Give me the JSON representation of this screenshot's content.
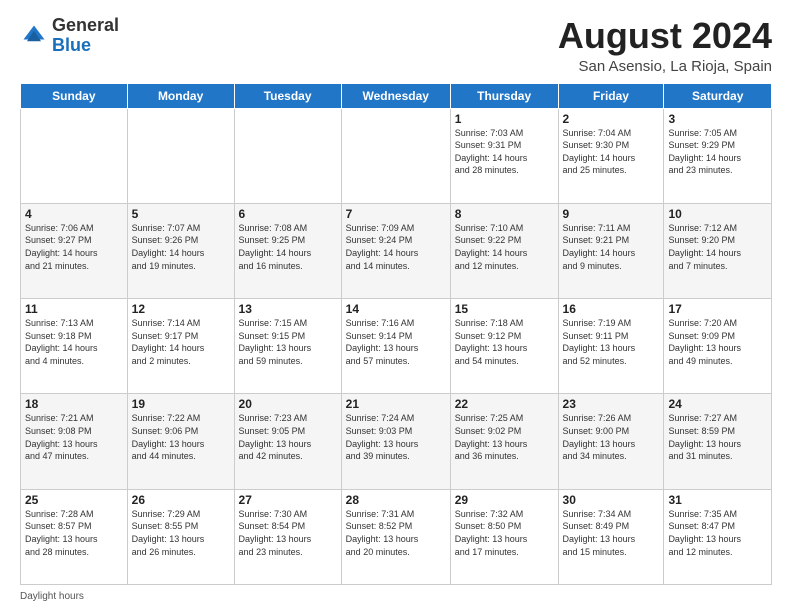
{
  "header": {
    "logo_general": "General",
    "logo_blue": "Blue",
    "month_year": "August 2024",
    "location": "San Asensio, La Rioja, Spain"
  },
  "days_of_week": [
    "Sunday",
    "Monday",
    "Tuesday",
    "Wednesday",
    "Thursday",
    "Friday",
    "Saturday"
  ],
  "weeks": [
    [
      {
        "day": "",
        "info": ""
      },
      {
        "day": "",
        "info": ""
      },
      {
        "day": "",
        "info": ""
      },
      {
        "day": "",
        "info": ""
      },
      {
        "day": "1",
        "info": "Sunrise: 7:03 AM\nSunset: 9:31 PM\nDaylight: 14 hours\nand 28 minutes."
      },
      {
        "day": "2",
        "info": "Sunrise: 7:04 AM\nSunset: 9:30 PM\nDaylight: 14 hours\nand 25 minutes."
      },
      {
        "day": "3",
        "info": "Sunrise: 7:05 AM\nSunset: 9:29 PM\nDaylight: 14 hours\nand 23 minutes."
      }
    ],
    [
      {
        "day": "4",
        "info": "Sunrise: 7:06 AM\nSunset: 9:27 PM\nDaylight: 14 hours\nand 21 minutes."
      },
      {
        "day": "5",
        "info": "Sunrise: 7:07 AM\nSunset: 9:26 PM\nDaylight: 14 hours\nand 19 minutes."
      },
      {
        "day": "6",
        "info": "Sunrise: 7:08 AM\nSunset: 9:25 PM\nDaylight: 14 hours\nand 16 minutes."
      },
      {
        "day": "7",
        "info": "Sunrise: 7:09 AM\nSunset: 9:24 PM\nDaylight: 14 hours\nand 14 minutes."
      },
      {
        "day": "8",
        "info": "Sunrise: 7:10 AM\nSunset: 9:22 PM\nDaylight: 14 hours\nand 12 minutes."
      },
      {
        "day": "9",
        "info": "Sunrise: 7:11 AM\nSunset: 9:21 PM\nDaylight: 14 hours\nand 9 minutes."
      },
      {
        "day": "10",
        "info": "Sunrise: 7:12 AM\nSunset: 9:20 PM\nDaylight: 14 hours\nand 7 minutes."
      }
    ],
    [
      {
        "day": "11",
        "info": "Sunrise: 7:13 AM\nSunset: 9:18 PM\nDaylight: 14 hours\nand 4 minutes."
      },
      {
        "day": "12",
        "info": "Sunrise: 7:14 AM\nSunset: 9:17 PM\nDaylight: 14 hours\nand 2 minutes."
      },
      {
        "day": "13",
        "info": "Sunrise: 7:15 AM\nSunset: 9:15 PM\nDaylight: 13 hours\nand 59 minutes."
      },
      {
        "day": "14",
        "info": "Sunrise: 7:16 AM\nSunset: 9:14 PM\nDaylight: 13 hours\nand 57 minutes."
      },
      {
        "day": "15",
        "info": "Sunrise: 7:18 AM\nSunset: 9:12 PM\nDaylight: 13 hours\nand 54 minutes."
      },
      {
        "day": "16",
        "info": "Sunrise: 7:19 AM\nSunset: 9:11 PM\nDaylight: 13 hours\nand 52 minutes."
      },
      {
        "day": "17",
        "info": "Sunrise: 7:20 AM\nSunset: 9:09 PM\nDaylight: 13 hours\nand 49 minutes."
      }
    ],
    [
      {
        "day": "18",
        "info": "Sunrise: 7:21 AM\nSunset: 9:08 PM\nDaylight: 13 hours\nand 47 minutes."
      },
      {
        "day": "19",
        "info": "Sunrise: 7:22 AM\nSunset: 9:06 PM\nDaylight: 13 hours\nand 44 minutes."
      },
      {
        "day": "20",
        "info": "Sunrise: 7:23 AM\nSunset: 9:05 PM\nDaylight: 13 hours\nand 42 minutes."
      },
      {
        "day": "21",
        "info": "Sunrise: 7:24 AM\nSunset: 9:03 PM\nDaylight: 13 hours\nand 39 minutes."
      },
      {
        "day": "22",
        "info": "Sunrise: 7:25 AM\nSunset: 9:02 PM\nDaylight: 13 hours\nand 36 minutes."
      },
      {
        "day": "23",
        "info": "Sunrise: 7:26 AM\nSunset: 9:00 PM\nDaylight: 13 hours\nand 34 minutes."
      },
      {
        "day": "24",
        "info": "Sunrise: 7:27 AM\nSunset: 8:59 PM\nDaylight: 13 hours\nand 31 minutes."
      }
    ],
    [
      {
        "day": "25",
        "info": "Sunrise: 7:28 AM\nSunset: 8:57 PM\nDaylight: 13 hours\nand 28 minutes."
      },
      {
        "day": "26",
        "info": "Sunrise: 7:29 AM\nSunset: 8:55 PM\nDaylight: 13 hours\nand 26 minutes."
      },
      {
        "day": "27",
        "info": "Sunrise: 7:30 AM\nSunset: 8:54 PM\nDaylight: 13 hours\nand 23 minutes."
      },
      {
        "day": "28",
        "info": "Sunrise: 7:31 AM\nSunset: 8:52 PM\nDaylight: 13 hours\nand 20 minutes."
      },
      {
        "day": "29",
        "info": "Sunrise: 7:32 AM\nSunset: 8:50 PM\nDaylight: 13 hours\nand 17 minutes."
      },
      {
        "day": "30",
        "info": "Sunrise: 7:34 AM\nSunset: 8:49 PM\nDaylight: 13 hours\nand 15 minutes."
      },
      {
        "day": "31",
        "info": "Sunrise: 7:35 AM\nSunset: 8:47 PM\nDaylight: 13 hours\nand 12 minutes."
      }
    ]
  ],
  "footer": {
    "daylight_label": "Daylight hours"
  }
}
